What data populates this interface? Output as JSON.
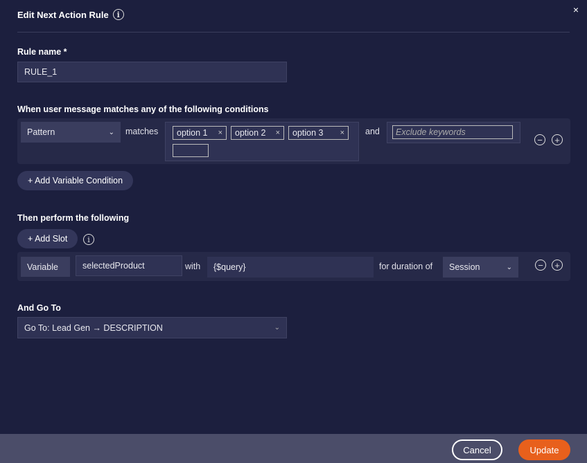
{
  "header": {
    "title": "Edit Next Action Rule",
    "close": "×"
  },
  "rule_name": {
    "label": "Rule name *",
    "value": "RULE_1"
  },
  "conditions": {
    "label": "When user message matches any of the following conditions",
    "type": "Pattern",
    "matches": "matches",
    "tags": [
      "option 1",
      "option 2",
      "option 3"
    ],
    "and": "and",
    "exclude_placeholder": "Exclude keywords",
    "add_variable": "+ Add Variable Condition"
  },
  "perform": {
    "label": "Then perform the following",
    "add_slot": "+ Add Slot",
    "slot_type": "Variable",
    "slot_name": "selectedProduct",
    "with": "with",
    "value": "{$query}",
    "duration_label": "for duration of",
    "duration": "Session"
  },
  "goto": {
    "label": "And Go To",
    "value": "Go To: Lead Gen → DESCRIPTION"
  },
  "footer": {
    "cancel": "Cancel",
    "update": "Update"
  },
  "colors": {
    "background": "#1c1f3e",
    "accent": "#e8601c"
  }
}
